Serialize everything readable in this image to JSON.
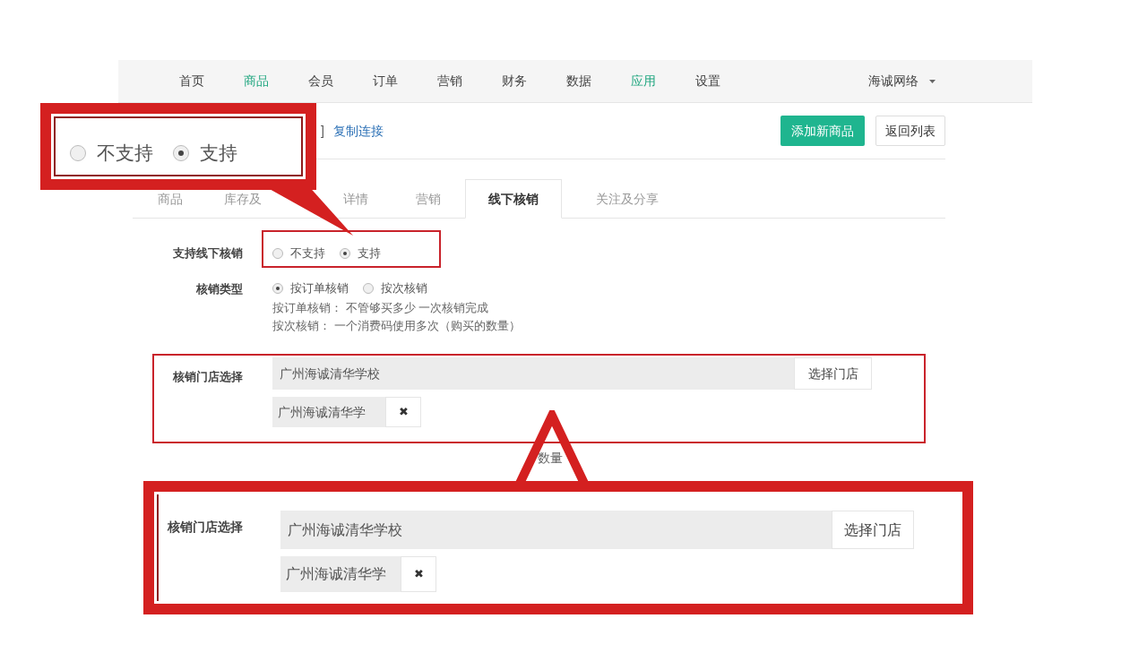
{
  "nav": {
    "items": [
      {
        "label": "首页",
        "highlighted": false
      },
      {
        "label": "商品",
        "highlighted": true
      },
      {
        "label": "会员",
        "highlighted": false
      },
      {
        "label": "订单",
        "highlighted": false
      },
      {
        "label": "营销",
        "highlighted": false
      },
      {
        "label": "财务",
        "highlighted": false
      },
      {
        "label": "数据",
        "highlighted": false
      },
      {
        "label": "应用",
        "highlighted": true
      },
      {
        "label": "设置",
        "highlighted": false
      }
    ],
    "account": "海诚网络"
  },
  "toolbar": {
    "fragment": "]",
    "link": "复制连接",
    "primary_button": "添加新商品",
    "secondary_button": "返回列表"
  },
  "tabs": [
    {
      "label": "商品",
      "selected": false
    },
    {
      "label": "库存及",
      "selected": false
    },
    {
      "label": "详情",
      "selected": false
    },
    {
      "label": "营销",
      "selected": false
    },
    {
      "label": "线下核销",
      "selected": true
    },
    {
      "label": "关注及分享",
      "selected": false
    }
  ],
  "form": {
    "support": {
      "label": "支持线下核销",
      "options": [
        {
          "label": "不支持",
          "selected": false
        },
        {
          "label": "支持",
          "selected": true
        }
      ]
    },
    "type": {
      "label": "核销类型",
      "options": [
        {
          "label": "按订单核销",
          "selected": true
        },
        {
          "label": "按次核销",
          "selected": false
        }
      ],
      "help": [
        "按订单核销： 不管够买多少 一次核销完成",
        "按次核销： 一个消费码使用多次（购买的数量）"
      ]
    },
    "store": {
      "label": "核销门店选择",
      "value": "广州海诚清华学校",
      "button": "选择门店",
      "tag": "广州海诚清华学",
      "remove": "✖"
    },
    "partial_text": "数量"
  },
  "callouts": {
    "support": {
      "options": [
        {
          "label": "不支持",
          "selected": false
        },
        {
          "label": "支持",
          "selected": true
        }
      ]
    },
    "store": {
      "label": "核销门店选择",
      "value": "广州海诚清华学校",
      "button": "选择门店",
      "tag": "广州海诚清华学",
      "remove": "✖"
    }
  }
}
